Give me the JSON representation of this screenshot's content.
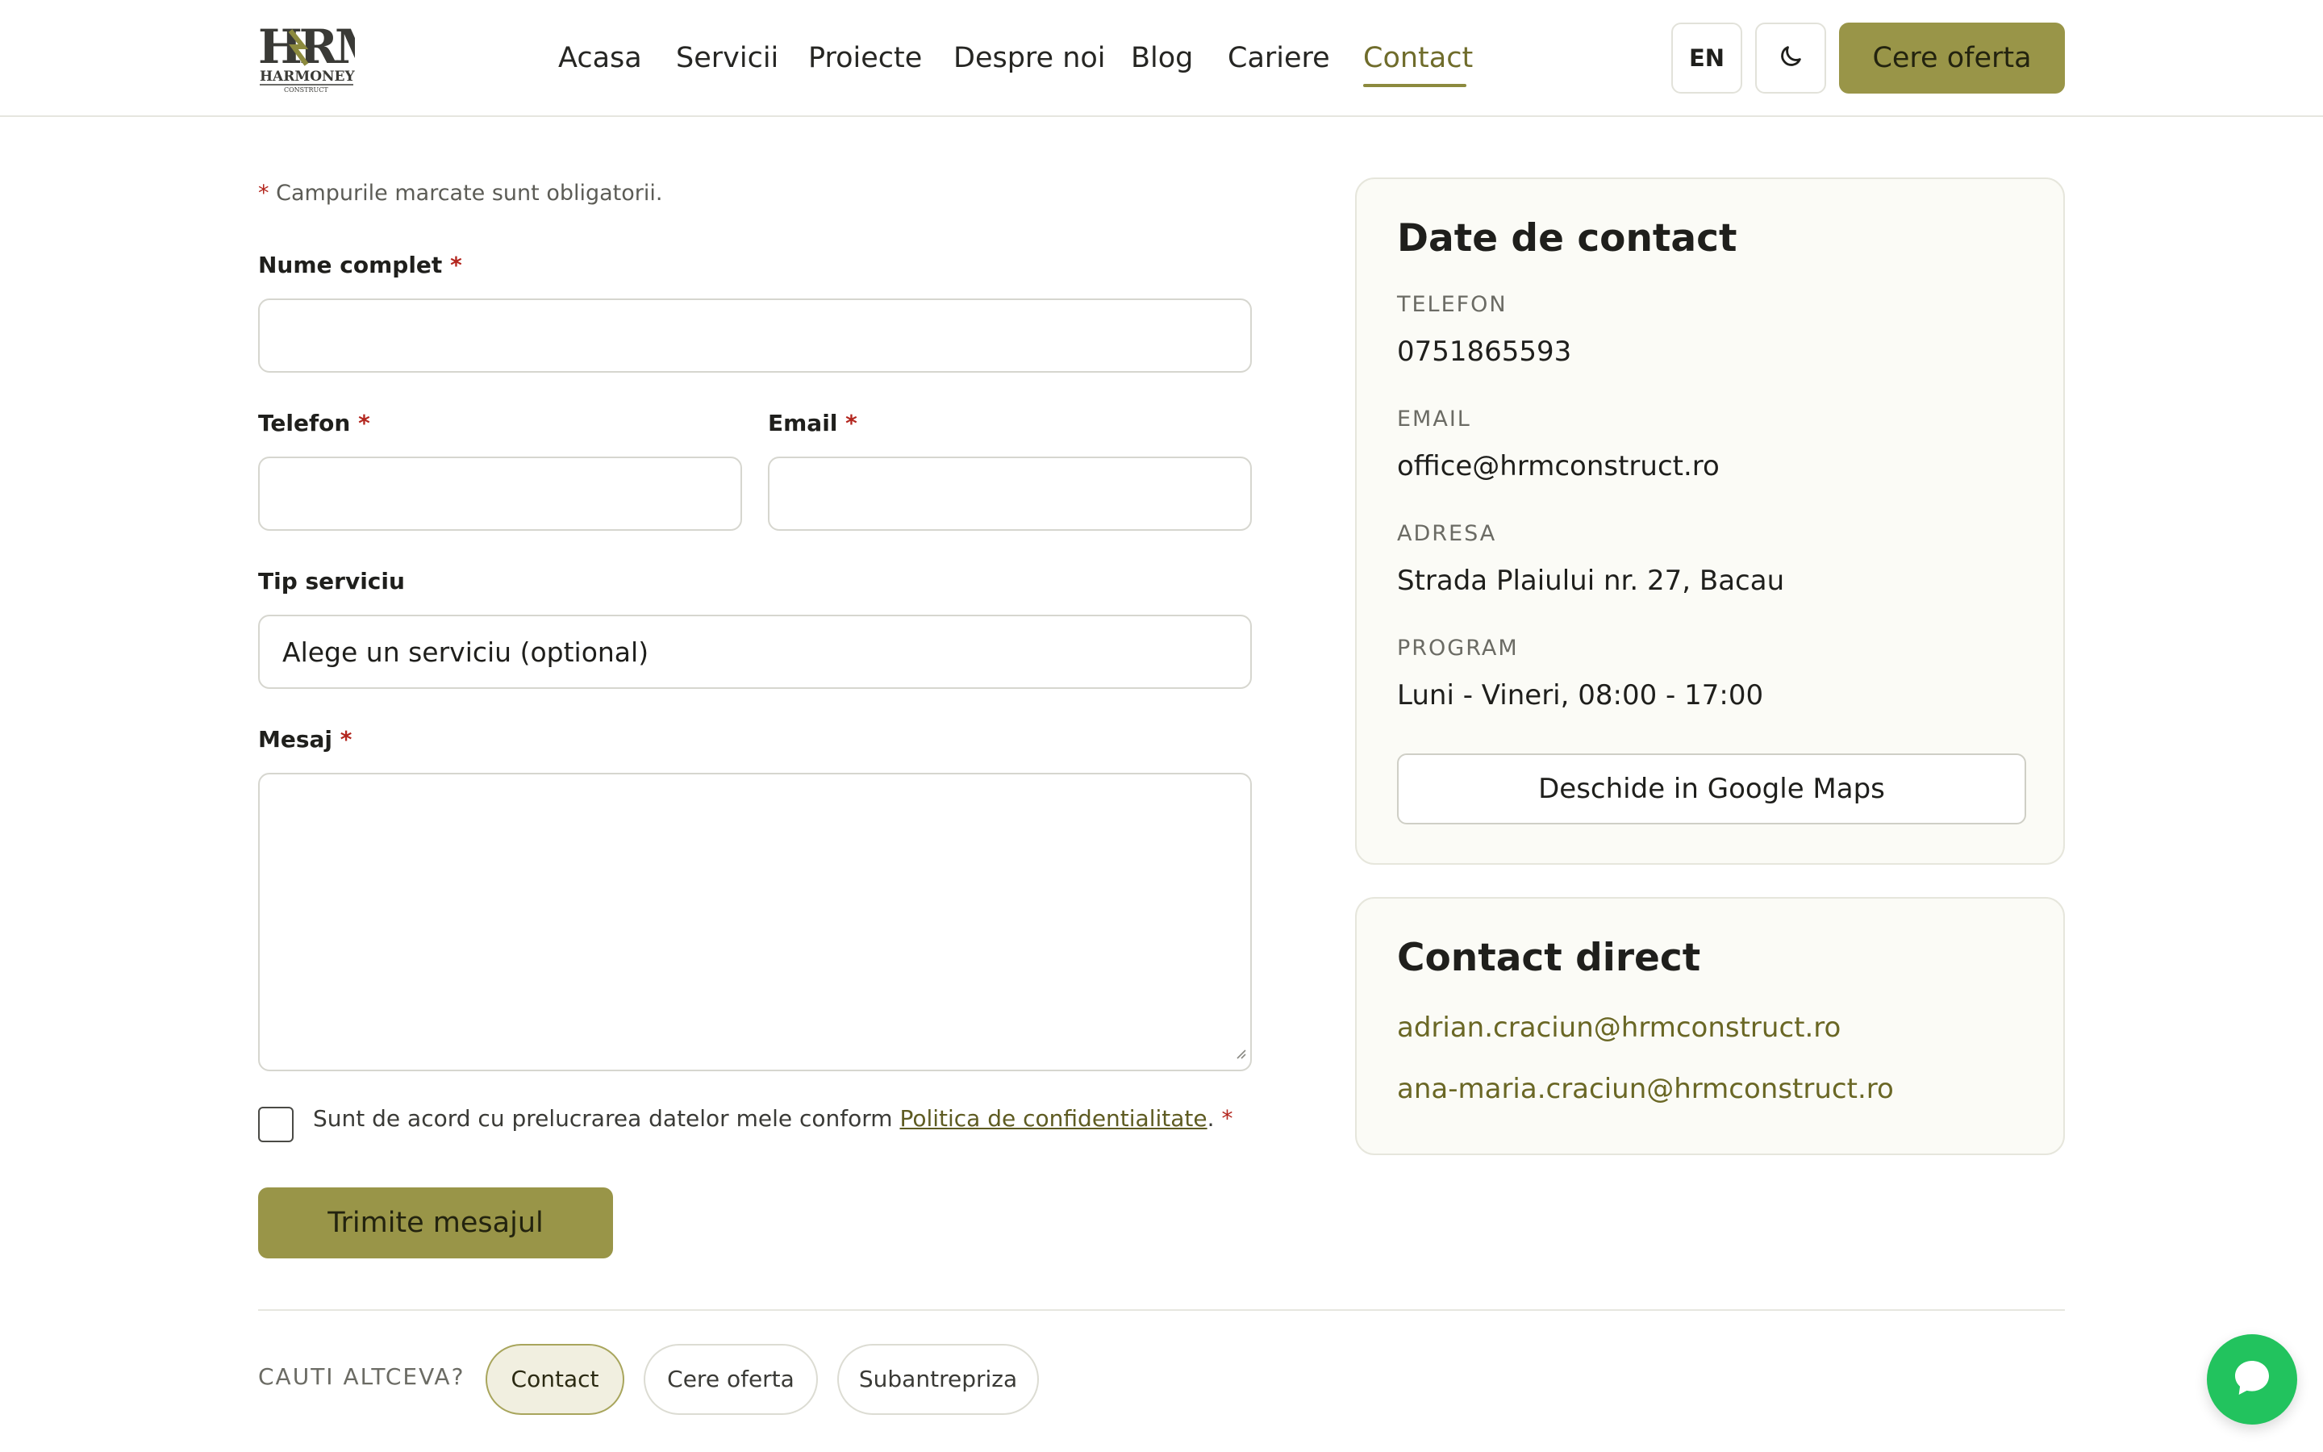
{
  "brand": {
    "logo_text": "HRM",
    "logo_sub": "HARMONEY",
    "logo_sub2": "CONSTRUCT"
  },
  "nav": [
    {
      "label": "Acasa"
    },
    {
      "label": "Servicii"
    },
    {
      "label": "Proiecte"
    },
    {
      "label": "Despre noi"
    },
    {
      "label": "Blog"
    },
    {
      "label": "Cariere"
    },
    {
      "label": "Contact",
      "active": true
    }
  ],
  "header": {
    "lang_label": "EN",
    "theme_icon": "moon-icon",
    "cta_label": "Cere oferta"
  },
  "form": {
    "required_note": "Campurile marcate sunt obligatorii.",
    "required_mark": "*",
    "name_label": "Nume complet",
    "phone_label": "Telefon",
    "email_label": "Email",
    "service_label": "Tip serviciu",
    "service_placeholder": "Alege un serviciu (optional)",
    "message_label": "Mesaj",
    "consent_text": "Sunt de acord cu prelucrarea datelor mele conform ",
    "consent_link": "Politica de confidentialitate",
    "consent_end": ".",
    "submit_label": "Trimite mesajul"
  },
  "contact_card": {
    "title": "Date de contact",
    "phone_label": "TELEFON",
    "phone_value": "0751865593",
    "email_label": "EMAIL",
    "email_value": "office@hrmconstruct.ro",
    "address_label": "ADRESA",
    "address_value": "Strada Plaiului nr. 27, Bacau",
    "program_label": "PROGRAM",
    "program_value": "Luni - Vineri, 08:00 - 17:00",
    "maps_label": "Deschide in Google Maps"
  },
  "direct_card": {
    "title": "Contact direct",
    "emails": [
      "adrian.craciun@hrmconstruct.ro",
      "ana-maria.craciun@hrmconstruct.ro"
    ]
  },
  "bottom": {
    "label": "CAUTI ALTCEVA?",
    "chips": [
      {
        "label": "Contact",
        "active": true
      },
      {
        "label": "Cere oferta"
      },
      {
        "label": "Subantrepriza"
      }
    ]
  },
  "colors": {
    "accent": "#999548",
    "accent_text": "#6f6c2b",
    "required": "#b3261e",
    "chat": "#22c35e"
  },
  "chat_icon": "chat-bubble-icon"
}
